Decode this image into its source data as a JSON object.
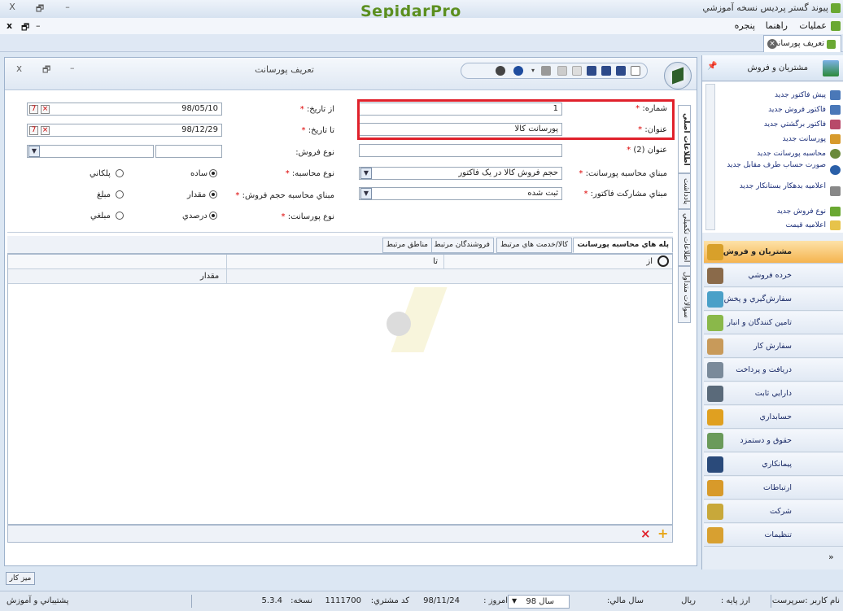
{
  "window": {
    "title": "پیوند گستر پردیس نسخه آموزشي",
    "logo": "SepidarPro",
    "controls": {
      "close": "X",
      "maximize": "🗗",
      "minimize": "–"
    }
  },
  "menubar": {
    "items": [
      "عمليات",
      "راهنما",
      "پنجره"
    ],
    "mdi_controls": [
      "x",
      "🗗",
      "–"
    ]
  },
  "doc_tab": {
    "label": "تعريف پورسانت"
  },
  "form": {
    "title": "تعريف پورسانت",
    "controls": {
      "close": "x",
      "restore": "🗗",
      "minimize": "–"
    },
    "fields": {
      "number_label": "شماره:",
      "number_value": "1",
      "title_label": "عنوان:",
      "title_value": "پورسانت کالا",
      "title2_label": "عنوان (2)",
      "title2_value": "",
      "from_date_label": "از تاريخ:",
      "from_date_value": "98/05/10",
      "to_date_label": "تا تاريخ:",
      "to_date_value": "98/12/29",
      "sale_type_label": "نوع فروش:",
      "calc_base_label": "مبناي محاسبه پورسانت:",
      "calc_base_value": "حجم فروش کالا در يک فاکتور",
      "invoice_share_label": "مبناي مشارکت فاکتور:",
      "invoice_share_value": "ثبت شده",
      "calc_type_label": "نوع محاسبه:",
      "calc_type_options": [
        "ساده",
        "پلکاني"
      ],
      "volume_base_label": "مبناي محاسبه حجم فروش:",
      "volume_base_options": [
        "مقدار",
        "مبلغ"
      ],
      "commission_type_label": "نوع پورسانت:",
      "commission_type_options": [
        "درصدي",
        "مبلغي"
      ],
      "required_mark": "*"
    },
    "side_tabs": [
      "اطلاعات اصلي",
      "يادداشت",
      "اطلاعات تکميلي",
      "سوالات متداول"
    ],
    "sub_tabs": [
      "پله هاي محاسبه پورسانت",
      "کالا/خدمت هاي مرتبط",
      "فروشندگان مرتبط",
      "مناطق مرتبط"
    ],
    "grid": {
      "filter_from": "از",
      "filter_to": "تا",
      "column_amount": "مقدار"
    }
  },
  "right_panel": {
    "header": "مشتريان و فروش",
    "list_items": [
      "پيش فاکتور جديد",
      "فاکتور فروش جديد",
      "فاکتور برگشتي جديد",
      "پورسانت جديد",
      "محاسبه پورسانت جديد",
      "صورت حساب طرف مقابل جديد",
      "اعلاميه بدهکار بستانکار جديد",
      "نوع فروش جديد",
      "اعلاميه قيمت"
    ],
    "modules": [
      "مشتريان و فروش",
      "خرده فروشي",
      "سفارش‌گيري و پخش",
      "تامين کنندگان و انبار",
      "سفارش کار",
      "دريافت و پرداخت",
      "دارايي ثابت",
      "حسابداري",
      "حقوق و دستمزد",
      "پيمانکاري",
      "ارتباطات",
      "شرکت",
      "تنظيمات"
    ],
    "active_module": "مشتريان و فروش"
  },
  "bottom_button": "ميز کار",
  "statusbar": {
    "user": "نام کاربر :سرپرست",
    "base_currency": "ارز پايه :",
    "currency": "ريال",
    "fiscal_year_label": "سال مالي:",
    "fiscal_year": "سال 98",
    "today_label": "امروز :",
    "today": "98/11/24",
    "customer_code_label": "کد مشتري:",
    "customer_code": "1111700",
    "version_label": "نسخه:",
    "version": "5.3.4",
    "support": "پشتيباني و آموزش"
  },
  "colors": {
    "highlight": "#e0212b",
    "active_module": "#f5b44f",
    "logo": "#5b8f1f"
  }
}
